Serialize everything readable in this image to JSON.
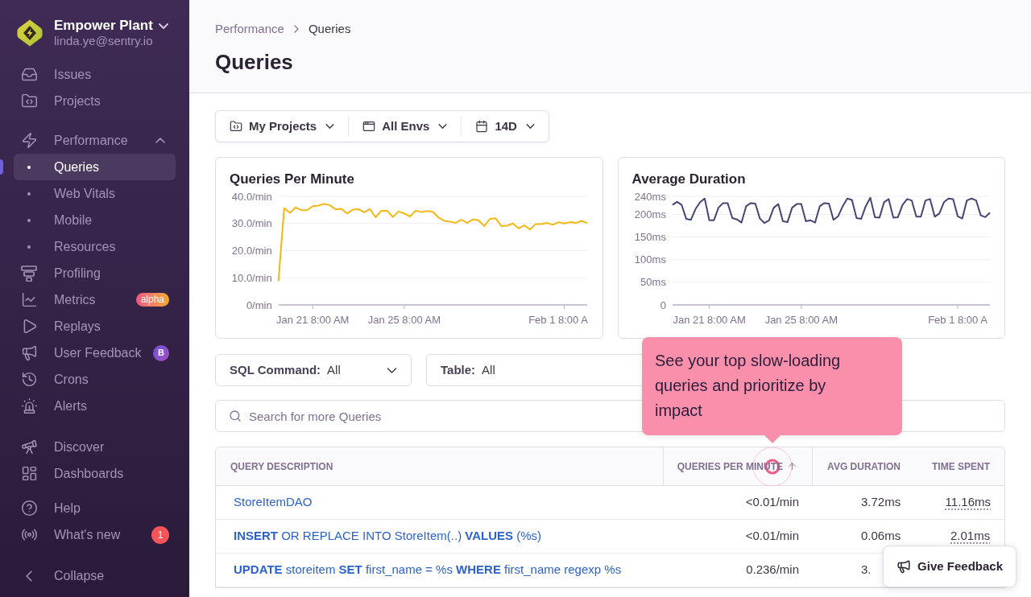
{
  "sidebar": {
    "org": {
      "name": "Empower Plant",
      "email": "linda.ye@sentry.io"
    },
    "sections": [
      {
        "items": [
          {
            "label": "Issues",
            "selected": false
          },
          {
            "label": "Projects",
            "selected": false
          }
        ]
      },
      {
        "items": [
          {
            "label": "Performance",
            "selected": false,
            "expanded": true,
            "children": [
              {
                "label": "Queries",
                "selected": true
              },
              {
                "label": "Web Vitals",
                "selected": false
              },
              {
                "label": "Mobile",
                "selected": false
              },
              {
                "label": "Resources",
                "selected": false
              }
            ]
          },
          {
            "label": "Profiling",
            "selected": false
          },
          {
            "label": "Metrics",
            "selected": false,
            "badge": {
              "kind": "pill",
              "text": "alpha"
            }
          },
          {
            "label": "Replays",
            "selected": false
          },
          {
            "label": "User Feedback",
            "selected": false,
            "badge": {
              "kind": "letter",
              "text": "B"
            }
          },
          {
            "label": "Crons",
            "selected": false
          },
          {
            "label": "Alerts",
            "selected": false
          }
        ]
      },
      {
        "items": [
          {
            "label": "Discover",
            "selected": false
          },
          {
            "label": "Dashboards",
            "selected": false
          }
        ]
      },
      {
        "items": [
          {
            "label": "Help",
            "selected": false
          },
          {
            "label": "What's new",
            "selected": false,
            "badge": {
              "kind": "count",
              "text": "1"
            }
          }
        ]
      }
    ],
    "collapse": {
      "label": "Collapse"
    }
  },
  "header": {
    "breadcrumbs": [
      {
        "label": "Performance"
      },
      {
        "label": "Queries"
      }
    ],
    "title": "Queries"
  },
  "page_filters": [
    {
      "label": "My Projects"
    },
    {
      "label": "All Envs"
    },
    {
      "label": "14D"
    }
  ],
  "charts": [
    {
      "chart_data": {
        "type": "line",
        "title": "Queries Per Minute",
        "grid": true,
        "categories": [
          null,
          null,
          null,
          null,
          null,
          null,
          "Jan 21 8:00 AM",
          null,
          null,
          null,
          null,
          null,
          null,
          null,
          null,
          null,
          null,
          null,
          null,
          null,
          null,
          null,
          "Jan 25 8:00 AM",
          null,
          null,
          null,
          null,
          null,
          null,
          null,
          null,
          null,
          null,
          null,
          null,
          null,
          null,
          null,
          null,
          null,
          null,
          null,
          null,
          null,
          null,
          null,
          null,
          null,
          null,
          null,
          "Feb 1 8:00 A",
          null,
          null,
          null,
          null
        ],
        "ylim": [
          0,
          40
        ],
        "yticks": [
          {
            "value": 0,
            "label": "0/min"
          },
          {
            "value": 10,
            "label": "10.0/min"
          },
          {
            "value": 20,
            "label": "20.0/min"
          },
          {
            "value": 30,
            "label": "30.0/min"
          },
          {
            "value": 40,
            "label": "40.0/min"
          }
        ],
        "series": [
          {
            "color": "#f2b712",
            "values": [
              8.8,
              35.6,
              33.9,
              35.9,
              34.9,
              34.9,
              36.4,
              36.6,
              37.2,
              36.7,
              35.2,
              35.4,
              33.7,
              35.1,
              35.3,
              34.1,
              35.3,
              32.3,
              34.7,
              34.7,
              32.4,
              34.4,
              33.7,
              32.6,
              34.7,
              34.2,
              34.6,
              34.3,
              32.2,
              31.0,
              30.7,
              30.2,
              31.4,
              30.2,
              31.5,
              31.2,
              29.0,
              31.7,
              31.9,
              29.0,
              29.2,
              30.0,
              28.2,
              29.3,
              27.8,
              29.8,
              29.8,
              30.2,
              29.5,
              30.5,
              30.0,
              30.5,
              30.2,
              30.9,
              30.2
            ]
          }
        ]
      }
    },
    {
      "chart_data": {
        "type": "line",
        "title": "Average Duration",
        "grid": true,
        "categories": [
          null,
          null,
          null,
          null,
          null,
          null,
          null,
          null,
          "Jan 21 8:00 AM",
          null,
          null,
          null,
          null,
          null,
          null,
          null,
          null,
          null,
          null,
          null,
          null,
          null,
          null,
          null,
          null,
          null,
          null,
          null,
          "Jan 25 8:00 AM",
          null,
          null,
          null,
          null,
          null,
          null,
          null,
          null,
          null,
          null,
          null,
          null,
          null,
          null,
          null,
          null,
          null,
          null,
          null,
          null,
          null,
          null,
          null,
          null,
          null,
          null,
          null,
          null,
          null,
          null,
          null,
          null,
          null,
          "Feb 1 8:00 A",
          null,
          null,
          null,
          null,
          null,
          null,
          null
        ],
        "ylim": [
          0,
          240
        ],
        "yticks": [
          {
            "value": 0,
            "label": "0"
          },
          {
            "value": 50,
            "label": "50ms"
          },
          {
            "value": 100,
            "label": "100ms"
          },
          {
            "value": 150,
            "label": "150ms"
          },
          {
            "value": 200,
            "label": "200ms"
          },
          {
            "value": 240,
            "label": "240ms"
          }
        ],
        "series": [
          {
            "color": "#444674",
            "values": [
              221,
              228,
              221,
              190,
              188,
              212,
              227,
              235,
              187,
              187,
              215,
              225,
              225,
              192,
              189,
              182,
              218,
              225,
              224,
              191,
              181,
              187,
              215,
              223,
              185,
              183,
              215,
              223,
              223,
              185,
              187,
              182,
              218,
              225,
              224,
              188,
              196,
              218,
              235,
              232,
              192,
              190,
              218,
              237,
              194,
              193,
              227,
              234,
              193,
              194,
              221,
              234,
              231,
              195,
              195,
              231,
              234,
              195,
              202,
              227,
              235,
              234,
              196,
              191,
              231,
              235,
              231,
              198,
              194,
              204
            ]
          }
        ]
      }
    }
  ],
  "filters": [
    {
      "label": "SQL Command:",
      "value": "All"
    },
    {
      "label": "Table:",
      "value": "All"
    }
  ],
  "search": {
    "placeholder": "Search for more Queries"
  },
  "table": {
    "columns": [
      {
        "label": "QUERY DESCRIPTION",
        "sorted": false
      },
      {
        "label": "QUERIES PER MINUTE",
        "sorted": true
      },
      {
        "label": "AVG DURATION",
        "sorted": false
      },
      {
        "label": "TIME SPENT",
        "sorted": false
      }
    ],
    "rows": [
      {
        "cells": [
          "StoreItemDAO",
          "<0.01/min",
          "3.72ms",
          "11.16ms"
        ]
      },
      {
        "cells": [
          "**INSERT** OR REPLACE INTO StoreItem(..) **VALUES** (%s)",
          "<0.01/min",
          "0.06ms",
          "2.01ms"
        ]
      },
      {
        "cells": [
          "**UPDATE** storeitem **SET** first_name = %s **WHERE** first_name regexp %s",
          "0.236/min",
          "3."
        ]
      }
    ]
  },
  "tour_tooltip": {
    "text": "See your top slow-loading queries and prioritize by impact"
  },
  "feedback_button": {
    "label": "Give Feedback"
  }
}
